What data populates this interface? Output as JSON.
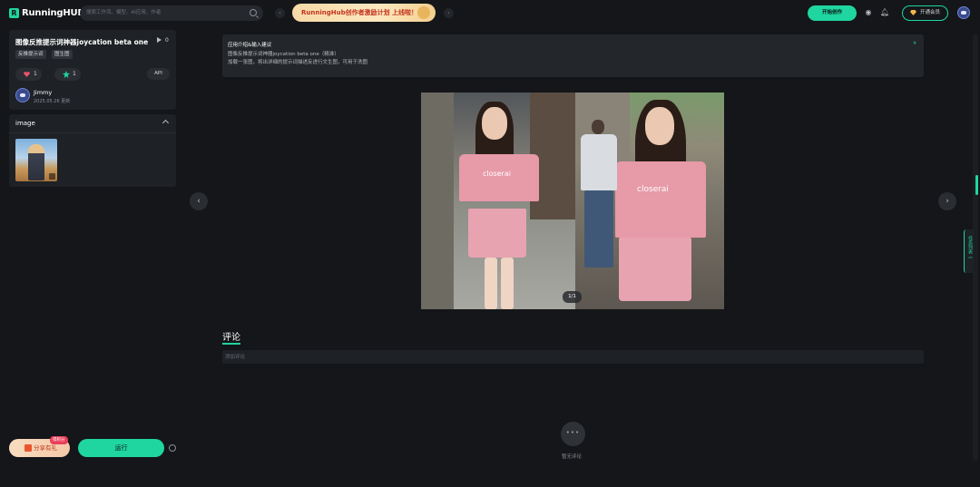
{
  "header": {
    "logo_letter": "R",
    "logo_text": "RunningHUB",
    "search_placeholder": "搜索工作流、模型、AI应用、作者",
    "banner_text": "RunningHub创作者激励计划 上线啦！",
    "prev_arrow": "‹",
    "next_arrow": "›",
    "create_label": "开始创作",
    "vip_label": "开通会员"
  },
  "app": {
    "title": "图像反推提示词神器joycation beta one（...",
    "run_count": "0",
    "tags": [
      "反推提示词",
      "图生图"
    ],
    "like_count": "1",
    "favorite_count": "1",
    "api_label": "API",
    "author_name": "Jimmy",
    "updated": "2025.05.26 更新"
  },
  "image_panel": {
    "title": "image"
  },
  "actions": {
    "share_label": "分享有礼",
    "share_badge": "得积分",
    "run_label": "运行"
  },
  "intro": {
    "title": "应用介绍&输入建议",
    "line1": "图像反推提示词神器joycation beta one（精准）",
    "line2": "加载一张图，将出详细的提示词描述反进行文生图，可用于洗图",
    "expand_glyph": "»"
  },
  "viewer": {
    "shirt_text": "closerai",
    "counter": "1/1",
    "prev_glyph": "‹",
    "next_glyph": "›"
  },
  "comments": {
    "title": "评论",
    "placeholder": "添加评论",
    "empty_dots": "•••",
    "empty_text": "暂无评论"
  },
  "sidebar_tab": {
    "label": "任务列表《"
  },
  "colors": {
    "accent": "#1fd6a0",
    "background": "#141619",
    "panel": "#1e2125"
  }
}
